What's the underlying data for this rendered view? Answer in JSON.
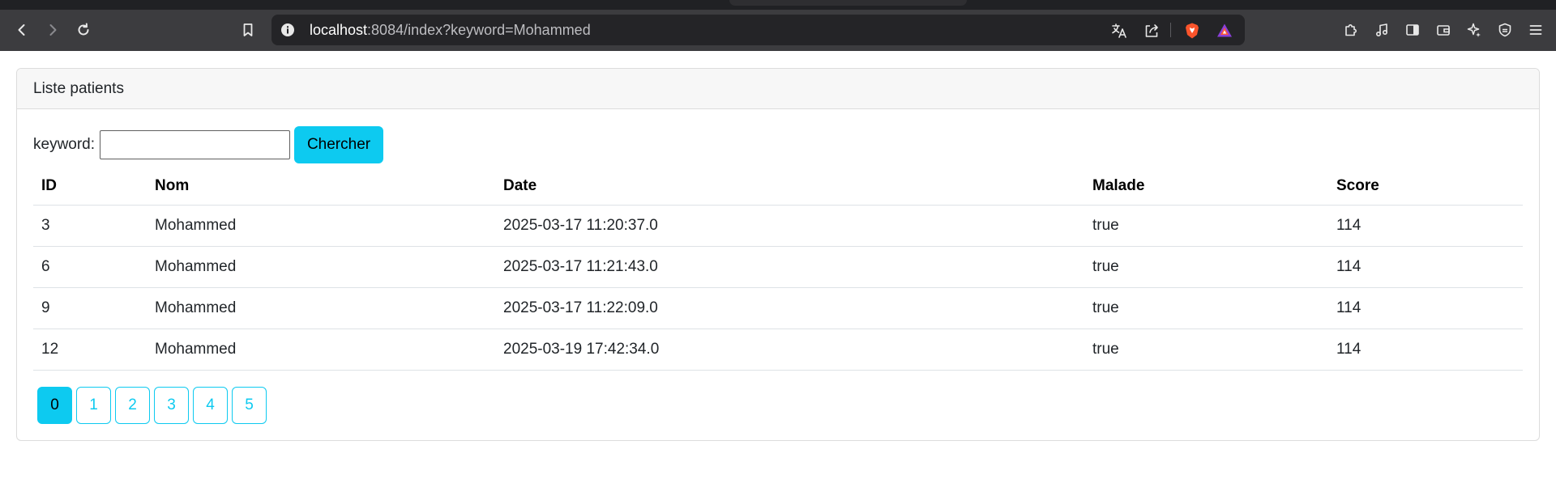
{
  "browser": {
    "url_host": "localhost",
    "url_rest": ":8084/index?keyword=Mohammed"
  },
  "card": {
    "title": "Liste patients"
  },
  "search": {
    "label": "keyword:",
    "value": "",
    "button_label": "Chercher"
  },
  "table": {
    "headers": [
      "ID",
      "Nom",
      "Date",
      "Malade",
      "Score"
    ],
    "rows": [
      [
        "3",
        "Mohammed",
        "2025-03-17 11:20:37.0",
        "true",
        "114"
      ],
      [
        "6",
        "Mohammed",
        "2025-03-17 11:21:43.0",
        "true",
        "114"
      ],
      [
        "9",
        "Mohammed",
        "2025-03-17 11:22:09.0",
        "true",
        "114"
      ],
      [
        "12",
        "Mohammed",
        "2025-03-19 17:42:34.0",
        "true",
        "114"
      ]
    ]
  },
  "pagination": {
    "pages": [
      "0",
      "1",
      "2",
      "3",
      "4",
      "5"
    ],
    "current": "0"
  },
  "colors": {
    "accent": "#0dcaf0",
    "chrome": "#3c3c3f"
  }
}
